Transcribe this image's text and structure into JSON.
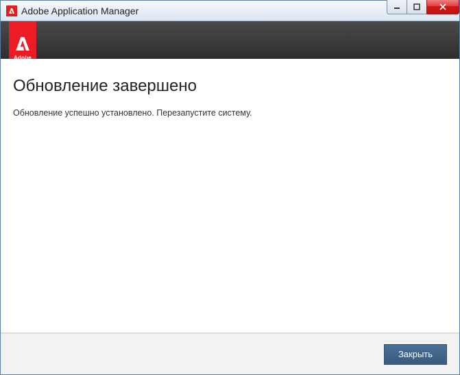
{
  "window": {
    "title": "Adobe Application Manager"
  },
  "brand": {
    "label": "Adobe"
  },
  "content": {
    "heading": "Обновление завершено",
    "message": "Обновление успешно установлено. Перезапустите систему."
  },
  "footer": {
    "close_label": "Закрыть"
  }
}
